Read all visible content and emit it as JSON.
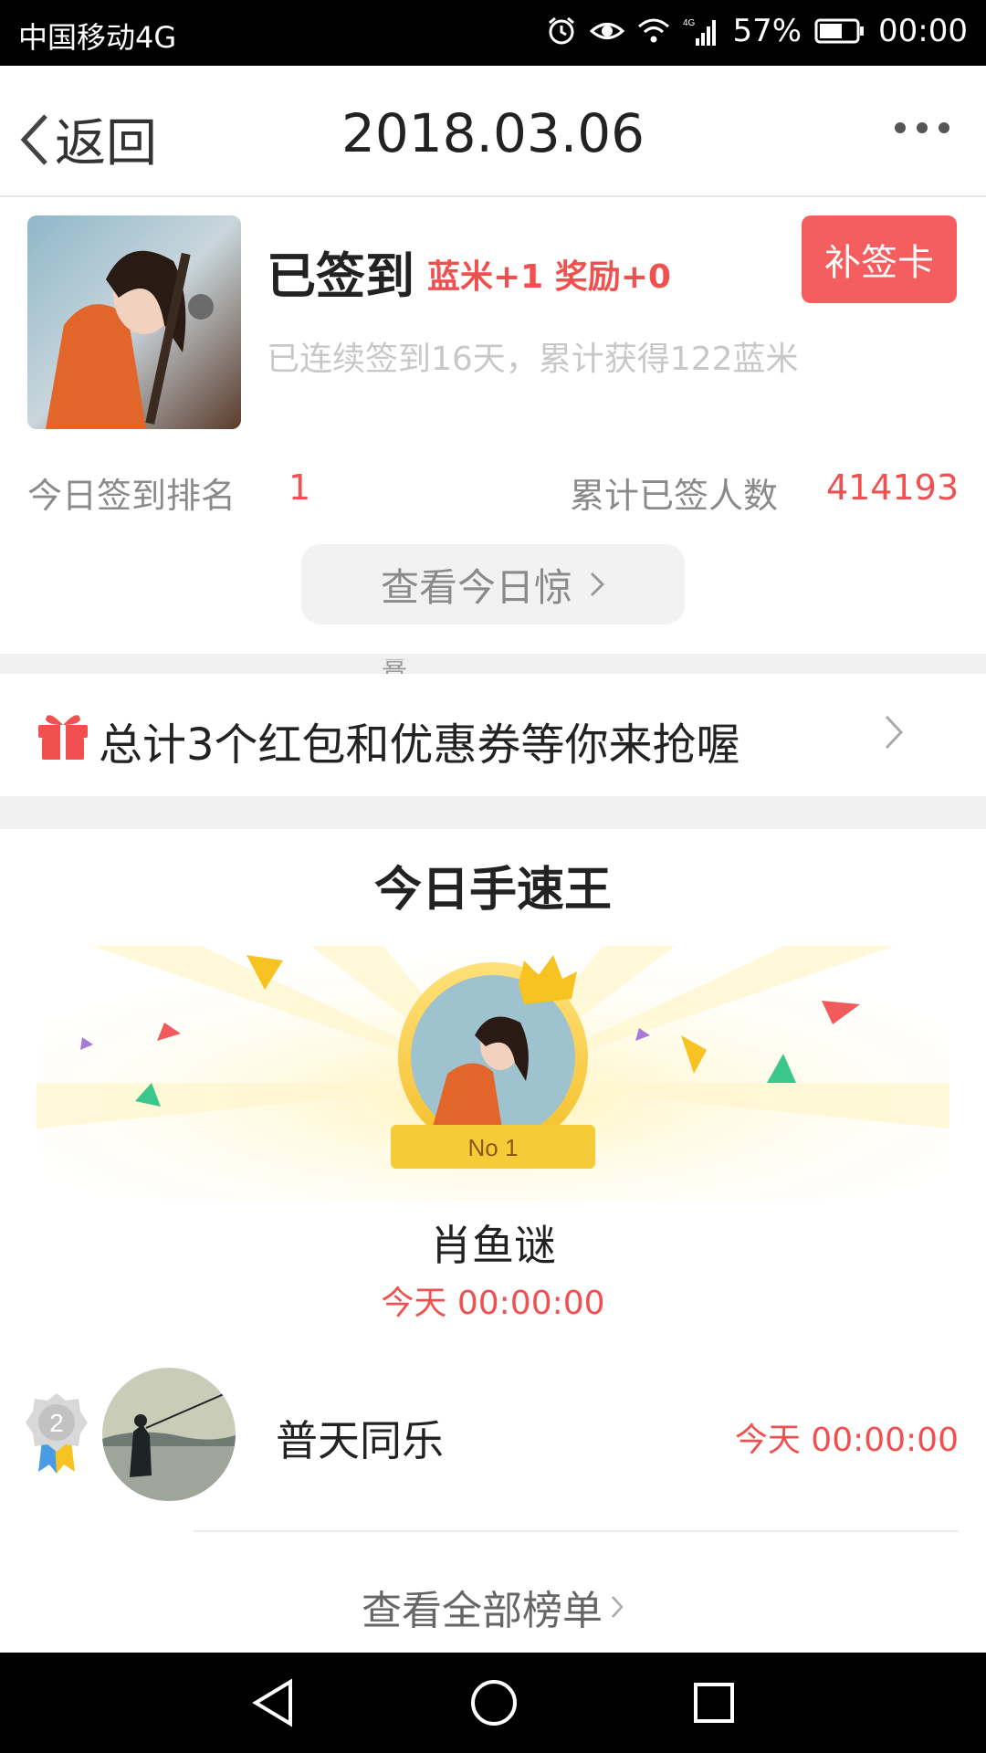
{
  "status_bar": {
    "carrier": "中国移动4G",
    "battery": "57%",
    "time": "00:00",
    "icons": [
      "alarm-icon",
      "eye-icon",
      "wifi-icon",
      "signal-icon",
      "battery-icon"
    ]
  },
  "nav": {
    "back_label": "返回",
    "title": "2018.03.06",
    "more_icon": "more-dots-icon"
  },
  "signin": {
    "status": "已签到",
    "reward": "蓝米+1 奖励+0",
    "makeup_button": "补签卡",
    "streak_text": "已连续签到16天，累计获得122蓝米",
    "rank_label": "今日签到排名",
    "rank_value": "1",
    "total_label": "累计已签人数",
    "total_value": "414193",
    "view_today_button": "查看今日惊"
  },
  "separator_fragment": "喜",
  "redpack": {
    "text": "总计3个红包和优惠券等你来抢喔",
    "icon": "gift-icon"
  },
  "speed_king": {
    "heading": "今日手速王",
    "winner": {
      "rank_badge": "No 1",
      "name": "肖鱼谜",
      "time": "今天 00:00:00"
    },
    "second": {
      "rank": "2",
      "name": "普天同乐",
      "time": "今天 00:00:00"
    },
    "view_all": "查看全部榜单"
  },
  "colors": {
    "accent_red": "#f0504f",
    "button_red": "#f55e5f",
    "gold": "#f5cf3a"
  }
}
